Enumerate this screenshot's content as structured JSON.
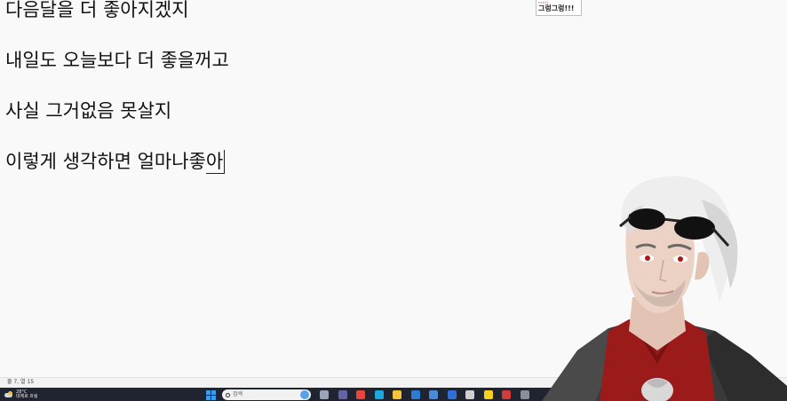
{
  "editor": {
    "lines": [
      "다음달을 더 좋아지겠지",
      "내일도 오늘보다 더 좋을꺼고",
      "사실 그거없음 못살지",
      "이렇게 생각하면 얼마나좋",
      "아"
    ]
  },
  "chat": {
    "top_text": "∙∙∙∙∙",
    "message": "그렁그렁!!!"
  },
  "statusbar": {
    "position_text": "줄 7, 열 15"
  },
  "taskbar": {
    "weather_temp": "28°C",
    "weather_desc": "대체로 흐림",
    "search_placeholder": "검색",
    "icons": [
      {
        "name": "task-view-icon",
        "color": "#9aa4b8"
      },
      {
        "name": "teams-icon",
        "color": "#6264a7"
      },
      {
        "name": "chrome-icon",
        "color": "#e8453c"
      },
      {
        "name": "edge-icon",
        "color": "#1fa8e0"
      },
      {
        "name": "file-explorer-icon",
        "color": "#f3c33d"
      },
      {
        "name": "mail-icon",
        "color": "#2b7cd3"
      },
      {
        "name": "store-icon",
        "color": "#4a8ad8"
      },
      {
        "name": "app-blue-icon",
        "color": "#2f6fd6"
      },
      {
        "name": "obs-icon",
        "color": "#d0d0d0"
      },
      {
        "name": "kakaotalk-icon",
        "color": "#f7d11e"
      },
      {
        "name": "app-red-icon",
        "color": "#d33b3b"
      },
      {
        "name": "app-gear-icon",
        "color": "#8a8f9c"
      }
    ]
  }
}
